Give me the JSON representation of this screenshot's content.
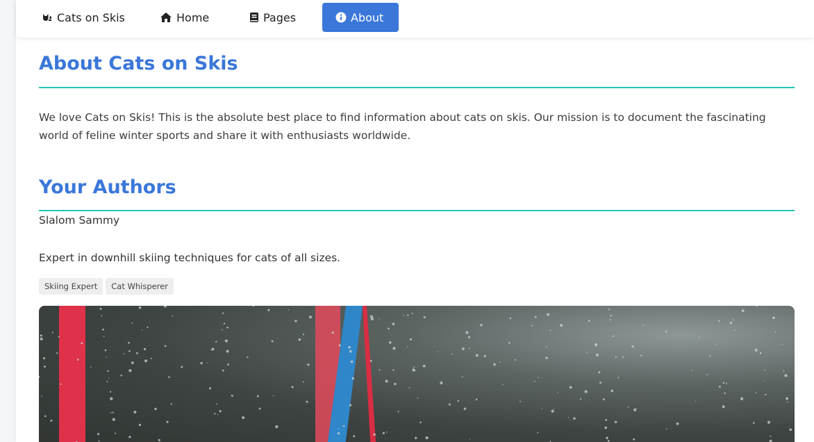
{
  "nav": {
    "brand_label": "Cats on Skis",
    "home_label": "Home",
    "pages_label": "Pages",
    "about_label": "About",
    "brand_icon": "cat-icon",
    "home_icon": "house-icon",
    "pages_icon": "book-icon",
    "about_icon": "info-circle-icon"
  },
  "about": {
    "heading": "About Cats on Skis",
    "text": "We love Cats on Skis! This is the absolute best place to find information about cats on skis. Our mission is to document the fascinating world of feline winter sports and share it with enthusiasts worldwide."
  },
  "authors": {
    "heading": "Your Authors",
    "items": [
      {
        "name": "Slalom Sammy",
        "bio": "Expert in downhill skiing techniques for cats of all sizes.",
        "tags": [
          "Skiing Expert",
          "Cat Whisperer"
        ]
      }
    ]
  },
  "colors": {
    "accent": "#3a77d9",
    "divider": "#20c4b5"
  }
}
